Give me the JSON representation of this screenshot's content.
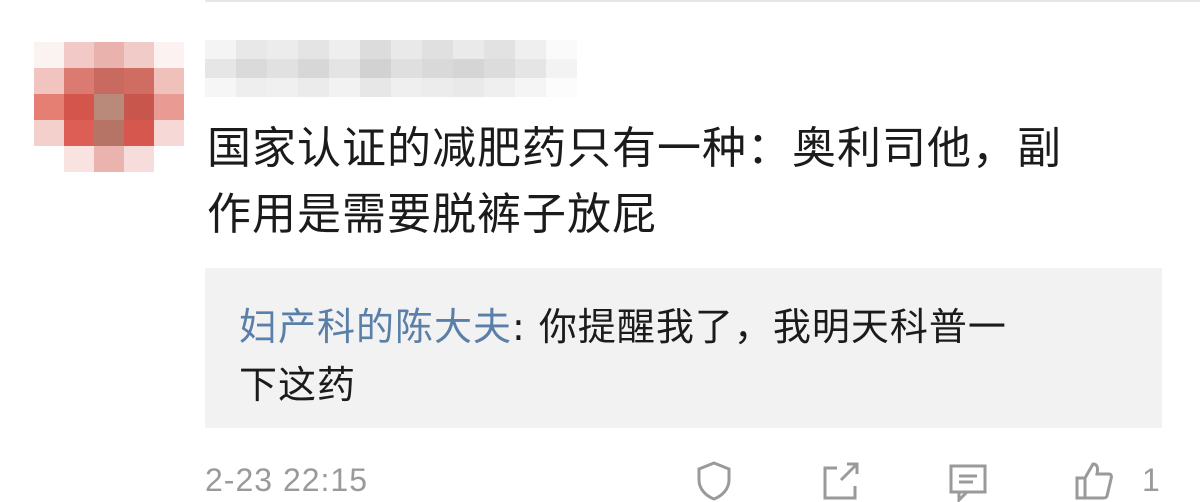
{
  "comment": {
    "username": "",
    "text_line1": "国家认证的减肥药只有一种：奥利司他，副",
    "text_line2": "作用是需要脱裤子放屁"
  },
  "reply": {
    "author": "妇产科的陈大夫",
    "separator": ": ",
    "text_line1": "你提醒我了，我明天科普一",
    "text_line2": "下这药"
  },
  "footer": {
    "timestamp": "2-23 22:15",
    "like_count": "1"
  },
  "icons": [
    "shield-icon",
    "share-icon",
    "comment-icon",
    "like-icon"
  ],
  "colors": {
    "reply_author": "#5a7fa8",
    "reply_background": "#f2f2f2",
    "meta_text": "#9a9a9a"
  }
}
